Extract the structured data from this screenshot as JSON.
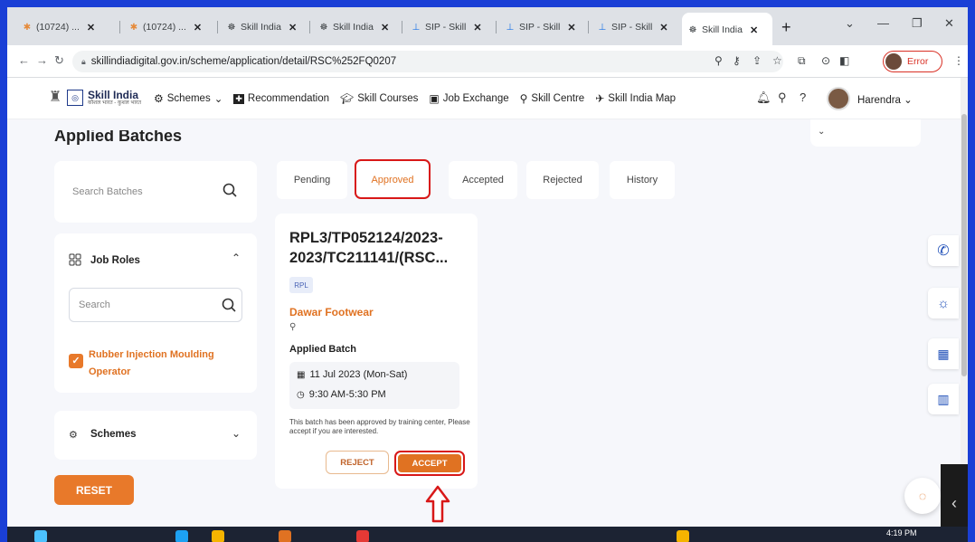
{
  "browser": {
    "tabs": [
      {
        "label": "(10724) ..."
      },
      {
        "label": "(10724) ..."
      },
      {
        "label": "Skill India"
      },
      {
        "label": "Skill India"
      },
      {
        "label": "SIP - Skill"
      },
      {
        "label": "SIP - Skill"
      },
      {
        "label": "SIP - Skill"
      },
      {
        "label": "Skill India"
      }
    ],
    "url": "skillindiadigital.gov.in/scheme/application/detail/RSC%252FQ0207",
    "profile_status": "Error"
  },
  "header": {
    "logo_title": "Skill India",
    "logo_tagline": "कौशल भारत - कुशल भारत",
    "menu": [
      {
        "label": "Schemes"
      },
      {
        "label": "Recommendation"
      },
      {
        "label": "Skill Courses"
      },
      {
        "label": "Job Exchange"
      },
      {
        "label": "Skill Centre"
      },
      {
        "label": "Skill India Map"
      }
    ],
    "user_name": "Harendra"
  },
  "page": {
    "title": "Applied Batches"
  },
  "sidebar": {
    "search_placeholder": "Search Batches",
    "job_roles_title": "Job Roles",
    "job_roles_search_placeholder": "Search",
    "job_role_selected": "Rubber Injection Moulding Operator",
    "schemes_title": "Schemes",
    "reset_label": "RESET"
  },
  "tabs": [
    {
      "label": "Pending"
    },
    {
      "label": "Approved"
    },
    {
      "label": "Accepted"
    },
    {
      "label": "Rejected"
    },
    {
      "label": "History"
    }
  ],
  "batch": {
    "title": "RPL3/TP052124/2023-2023/TC211141/(RSC...",
    "badge": "RPL",
    "company": "Dawar Footwear",
    "applied_label": "Applied Batch",
    "date": "11 Jul 2023 (Mon-Sat)",
    "time": "9:30 AM-5:30 PM",
    "note": "This batch has been approved by training center, Please accept if you are interested.",
    "reject_label": "REJECT",
    "accept_label": "ACCEPT"
  },
  "taskbar": {
    "clock": "4:19 PM"
  },
  "colors": {
    "accent": "#e8792a",
    "highlight": "#d81818",
    "frame": "#1a3fd6"
  }
}
